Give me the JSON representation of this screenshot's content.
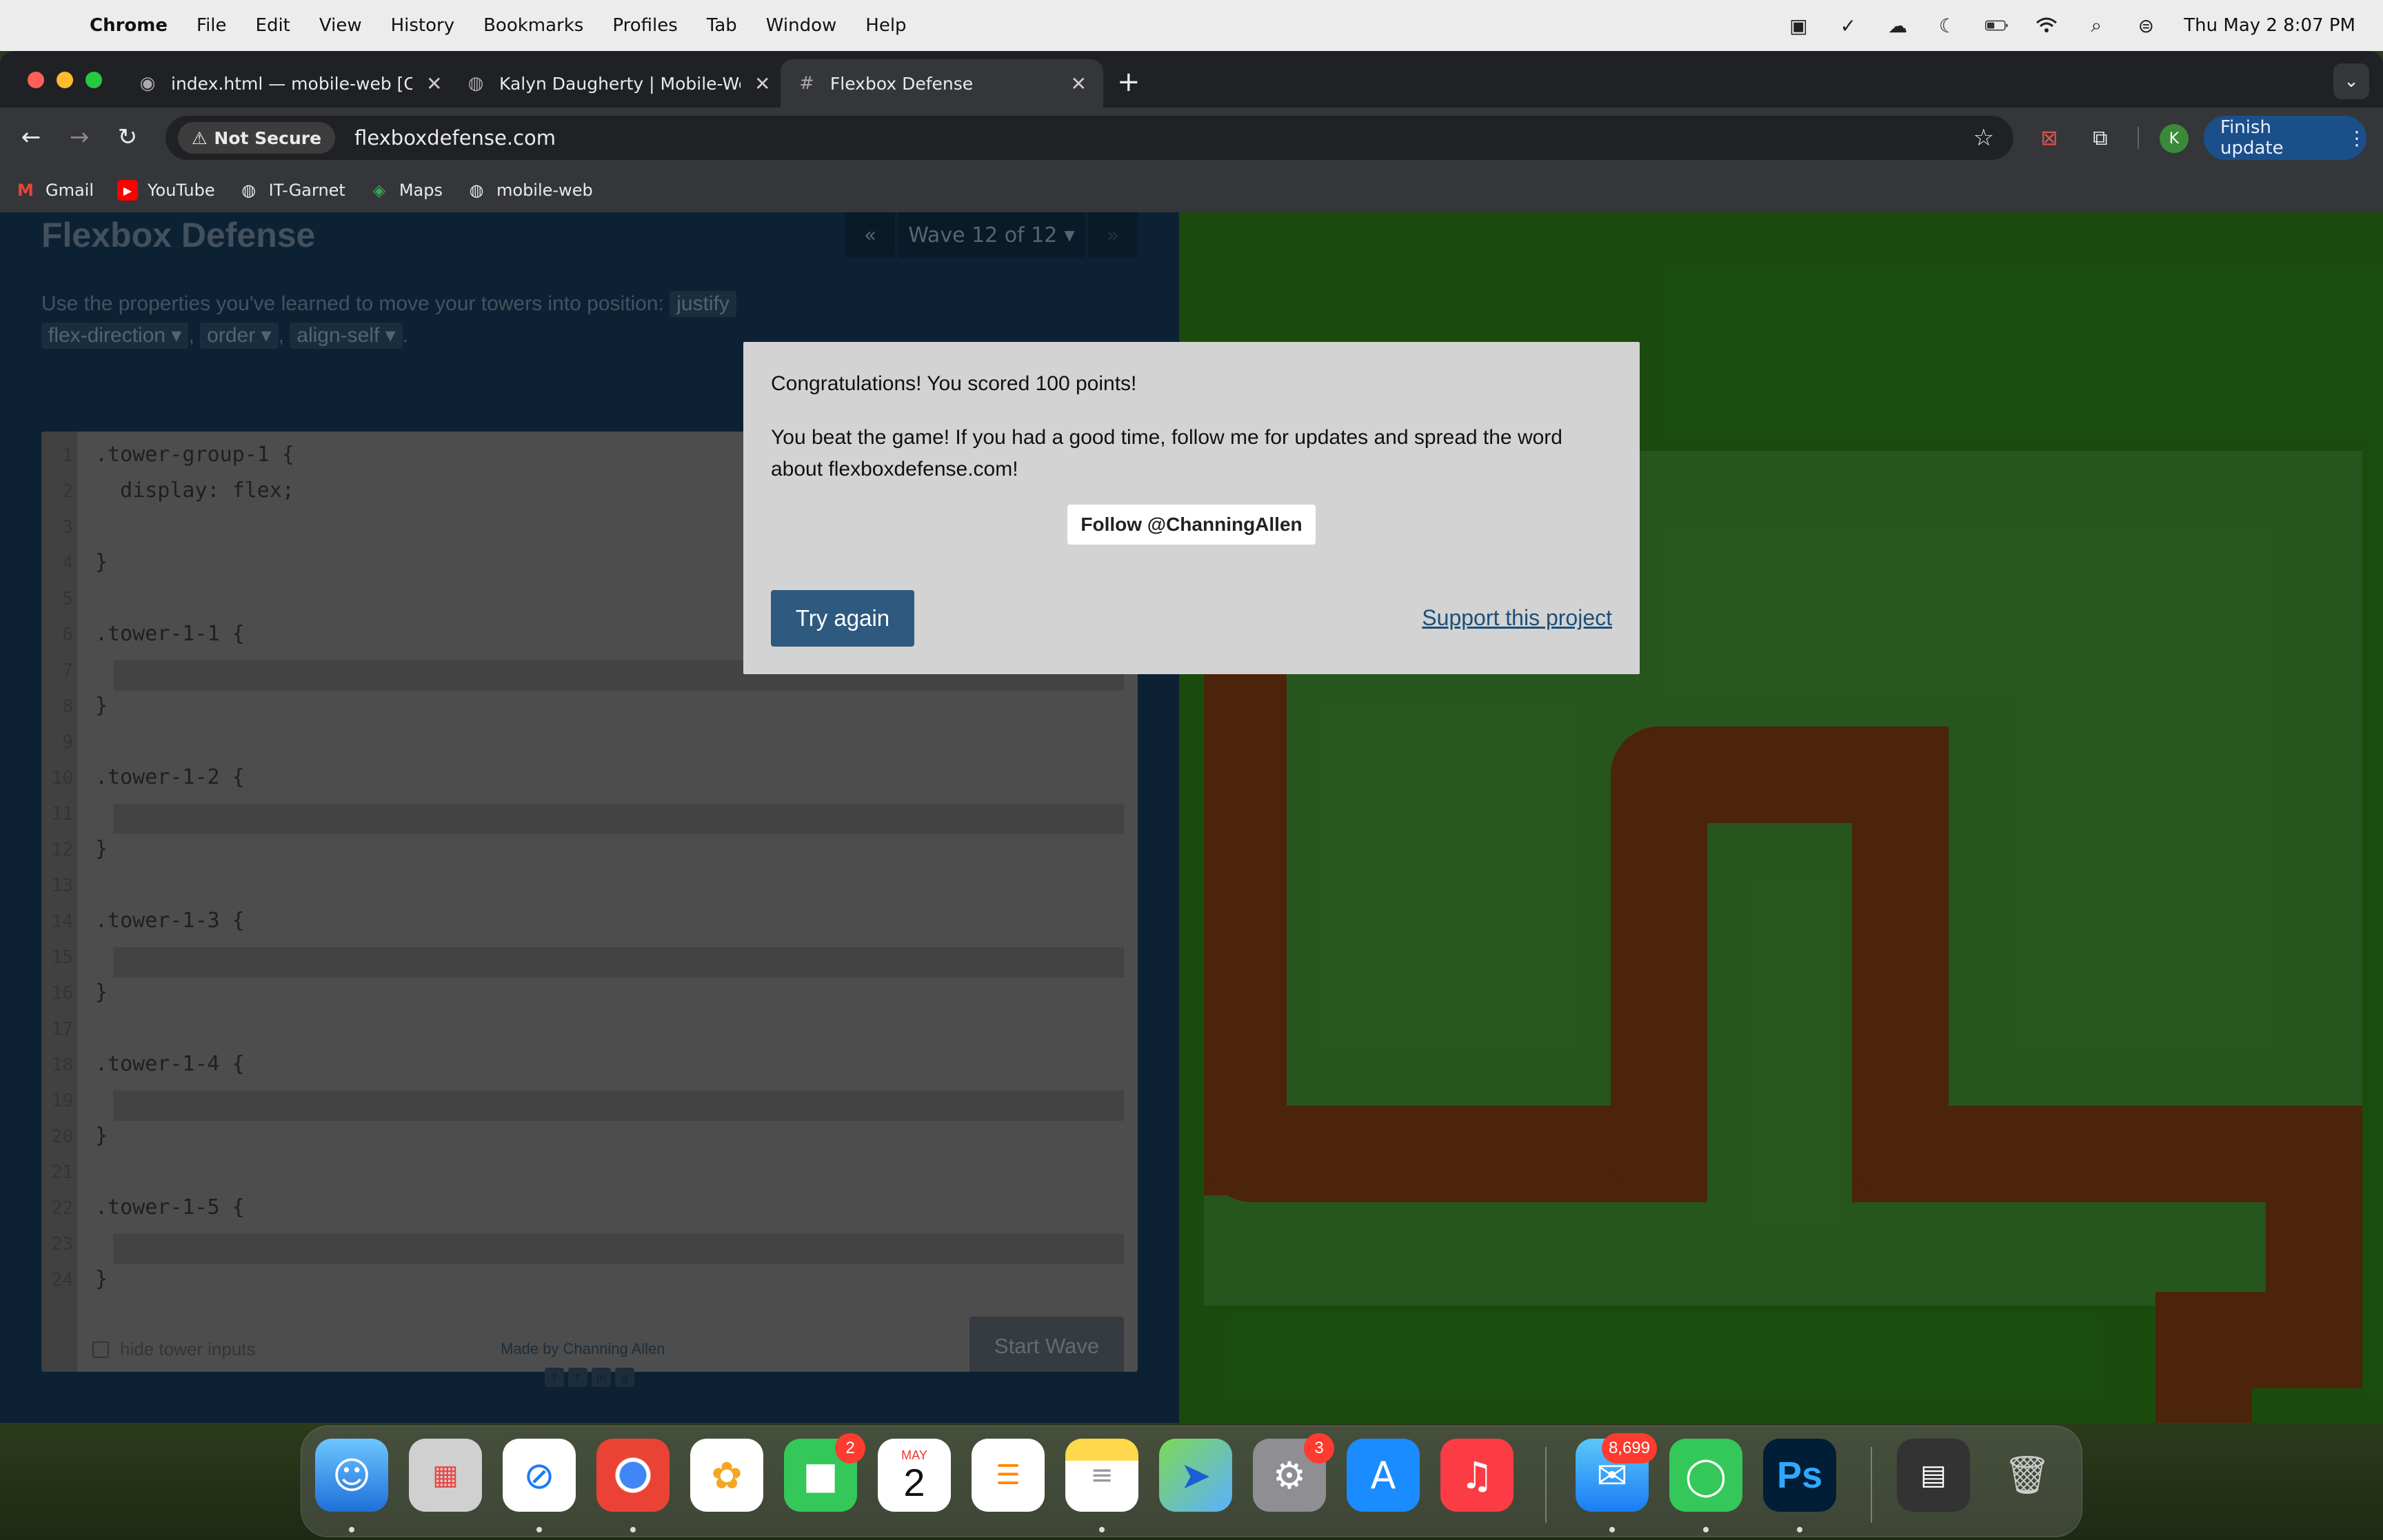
{
  "menubar": {
    "app_name": "Chrome",
    "items": [
      "File",
      "Edit",
      "View",
      "History",
      "Bookmarks",
      "Profiles",
      "Tab",
      "Window",
      "Help"
    ],
    "clock": "Thu May 2  8:07 PM"
  },
  "tabs": [
    {
      "title": "index.html — mobile-web [Co",
      "active": false
    },
    {
      "title": "Kalyn Daugherty | Mobile-We",
      "active": false
    },
    {
      "title": "Flexbox Defense",
      "active": true
    }
  ],
  "toolbar": {
    "security_label": "Not Secure",
    "url": "flexboxdefense.com",
    "profile_initial": "K",
    "finish_update_label": "Finish update"
  },
  "bookmarks": [
    {
      "label": "Gmail",
      "icon": "gmail-icon"
    },
    {
      "label": "YouTube",
      "icon": "youtube-icon"
    },
    {
      "label": "IT-Garnet",
      "icon": "globe-icon"
    },
    {
      "label": "Maps",
      "icon": "maps-icon"
    },
    {
      "label": "mobile-web",
      "icon": "globe-icon"
    }
  ],
  "game": {
    "title": "Flexbox Defense",
    "wave_label": "Wave 12 of 12",
    "instructions": "Use the properties you've learned to move your towers into position:",
    "properties": [
      "justify",
      "flex-direction",
      "order",
      "align-self"
    ],
    "code_lines": [
      {
        "n": "1",
        "text": ".tower-group-1 {"
      },
      {
        "n": "2",
        "text": "  display: flex;"
      },
      {
        "n": "3",
        "text": ""
      },
      {
        "n": "4",
        "text": "}"
      },
      {
        "n": "5",
        "text": ""
      },
      {
        "n": "6",
        "text": ".tower-1-1 {"
      },
      {
        "n": "7",
        "text": ""
      },
      {
        "n": "8",
        "text": "}"
      },
      {
        "n": "9",
        "text": ""
      },
      {
        "n": "10",
        "text": ".tower-1-2 {"
      },
      {
        "n": "11",
        "text": ""
      },
      {
        "n": "12",
        "text": "}"
      },
      {
        "n": "13",
        "text": ""
      },
      {
        "n": "14",
        "text": ".tower-1-3 {"
      },
      {
        "n": "15",
        "text": ""
      },
      {
        "n": "16",
        "text": "}"
      },
      {
        "n": "17",
        "text": ""
      },
      {
        "n": "18",
        "text": ".tower-1-4 {"
      },
      {
        "n": "19",
        "text": ""
      },
      {
        "n": "20",
        "text": "}"
      },
      {
        "n": "21",
        "text": ""
      },
      {
        "n": "22",
        "text": ".tower-1-5 {"
      },
      {
        "n": "23",
        "text": ""
      },
      {
        "n": "24",
        "text": "}"
      }
    ],
    "start_wave_label": "Start Wave",
    "hide_inputs_label": "hide tower inputs",
    "credit": "Made by Channing Allen"
  },
  "modal": {
    "score_text": "Congratulations! You scored 100 points!",
    "message": "You beat the game! If you had a good time, follow me for updates and spread the word about flexboxdefense.com!",
    "follow_label": "Follow @ChanningAllen",
    "try_again_label": "Try again",
    "support_label": "Support this project"
  },
  "dock": {
    "facetime_badge": "2",
    "calendar_month": "MAY",
    "calendar_day": "2",
    "settings_badge": "3",
    "mail_badge": "8,699"
  },
  "colors": {
    "accent": "#2e5a80",
    "board_green": "#3f8a31",
    "path_brown": "#7a3a12"
  }
}
